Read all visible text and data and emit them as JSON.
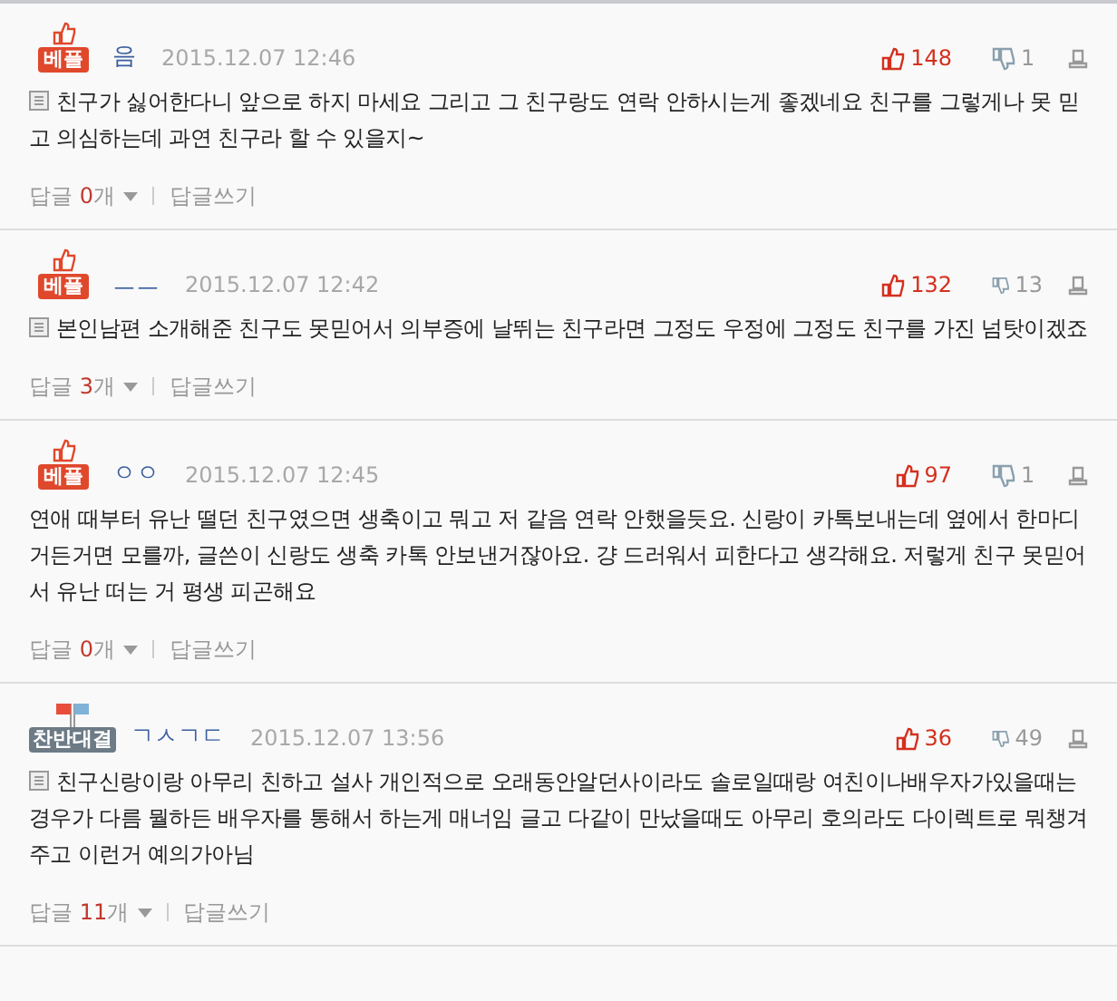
{
  "comments": [
    {
      "badge": {
        "kind": "best",
        "label": "베플"
      },
      "author": "음",
      "time": "2015.12.07 12:46",
      "likes": "148",
      "dislikes": "1",
      "mobile": true,
      "text": "친구가 싫어한다니 앞으로 하지 마세요 그리고 그 친구랑도 연락 안하시는게 좋겠네요 친구를 그렇게나 못 믿고 의심하는데 과연 친구라 할 수 있을지~",
      "reply_label": "답글",
      "reply_count": "0",
      "reply_unit": "개",
      "write_label": "답글쓰기"
    },
    {
      "badge": {
        "kind": "best",
        "label": "베플"
      },
      "author": "ㅡㅡ",
      "time": "2015.12.07 12:42",
      "likes": "132",
      "dislikes": "13",
      "mobile": true,
      "text": "본인남편 소개해준 친구도 못믿어서 의부증에 날뛰는 친구라면 그정도 우정에 그정도 친구를 가진 넘탓이겠죠",
      "reply_label": "답글",
      "reply_count": "3",
      "reply_unit": "개",
      "write_label": "답글쓰기"
    },
    {
      "badge": {
        "kind": "best",
        "label": "베플"
      },
      "author": "ㅇㅇ",
      "time": "2015.12.07 12:45",
      "likes": "97",
      "dislikes": "1",
      "mobile": false,
      "text": "연애 때부터 유난 떨던 친구였으면 생축이고 뭐고 저 같음 연락 안했을듯요. 신랑이 카톡보내는데 옆에서 한마디 거든거면 모를까, 글쓴이 신랑도 생축 카톡 안보낸거잖아요. 걍 드러워서 피한다고 생각해요. 저렇게 친구 못믿어서 유난 떠는 거 평생 피곤해요",
      "reply_label": "답글",
      "reply_count": "0",
      "reply_unit": "개",
      "write_label": "답글쓰기"
    },
    {
      "badge": {
        "kind": "debate",
        "label": "찬반대결"
      },
      "author": "ㄱㅅㄱㄷ",
      "time": "2015.12.07 13:56",
      "likes": "36",
      "dislikes": "49",
      "mobile": true,
      "text": "친구신랑이랑 아무리 친하고 설사 개인적으로 오래동안알던사이라도 솔로일때랑 여친이나배우자가있을때는 경우가 다름 뭘하든 배우자를 통해서 하는게 매너임 글고 다같이 만났을때도 아무리 호의라도 다이렉트로 뭐챙겨주고 이런거 예의가아님",
      "reply_label": "답글",
      "reply_count": "11",
      "reply_unit": "개",
      "write_label": "답글쓰기"
    }
  ]
}
